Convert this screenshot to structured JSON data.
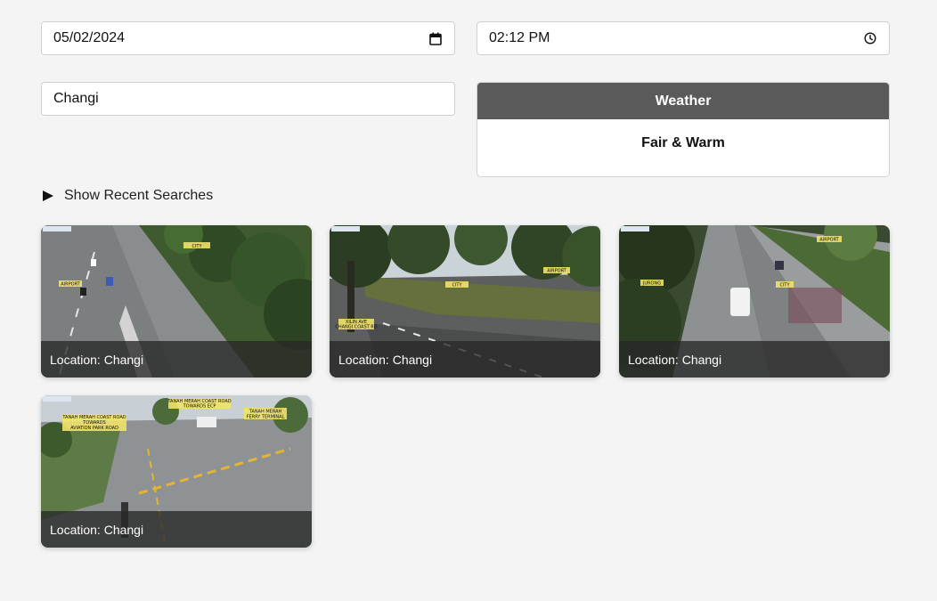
{
  "date_input": {
    "value": "05/02/2024",
    "icon": "calendar-icon"
  },
  "time_input": {
    "value": "02:12 PM",
    "icon": "clock-icon"
  },
  "location_input": {
    "value": "Changi"
  },
  "weather": {
    "title": "Weather",
    "forecast": "Fair & Warm"
  },
  "recent_searches": {
    "label": "Show Recent Searches"
  },
  "cameras": [
    {
      "caption": "Location: Changi",
      "signs": [
        "CITY",
        "AIRPORT"
      ]
    },
    {
      "caption": "Location: Changi",
      "signs": [
        "AIRPORT",
        "CITY",
        "XILIN AVE",
        "CHANGI COAST RD"
      ]
    },
    {
      "caption": "Location: Changi",
      "signs": [
        "AIRPORT",
        "JURONG",
        "CITY"
      ]
    },
    {
      "caption": "Location: Changi",
      "signs": [
        "TANAH MERAH COAST ROAD",
        "TOWARDS ECP",
        "TANAH MERAH COAST ROAD",
        "TOWARDS",
        "AVIATION PARK ROAD",
        "TANAH MERAH",
        "FERRY TERMINAL"
      ]
    }
  ]
}
